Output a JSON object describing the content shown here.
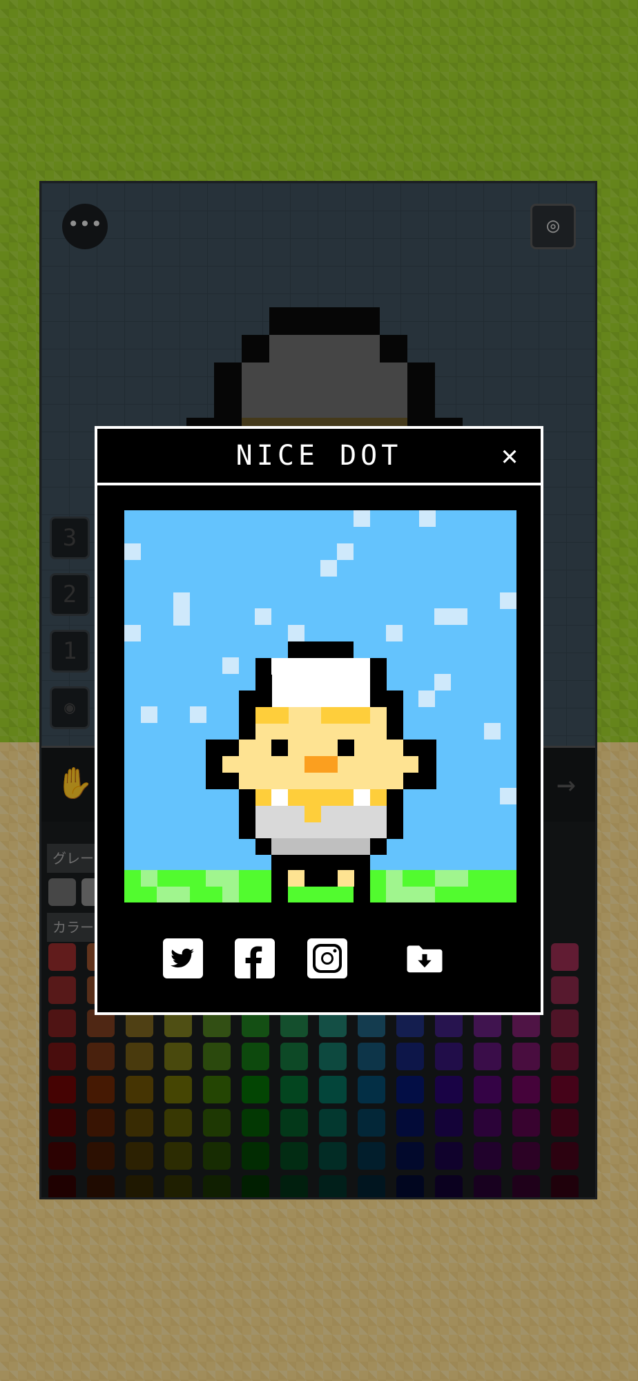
{
  "background": {
    "grass_color": "#9ccc2a",
    "sand_color": "#f7d98c"
  },
  "editor": {
    "menu_icon": "ellipsis-icon",
    "camera_icon": "camera-icon",
    "layers": [
      "3",
      "2",
      "1"
    ],
    "visibility_icon": "eye-icon",
    "hand_tool_icon": "hand-icon",
    "redo_icon": "arrow-right-icon",
    "palette": {
      "gray_label": "グレー",
      "color_label": "カラー"
    }
  },
  "dialog": {
    "title": "NICE DOT",
    "close_icon": "close-icon",
    "share_buttons": [
      {
        "name": "twitter-icon"
      },
      {
        "name": "facebook-icon"
      },
      {
        "name": "instagram-icon"
      },
      {
        "name": "save-folder-icon"
      }
    ],
    "art_bg_color": "#64c3fd"
  }
}
